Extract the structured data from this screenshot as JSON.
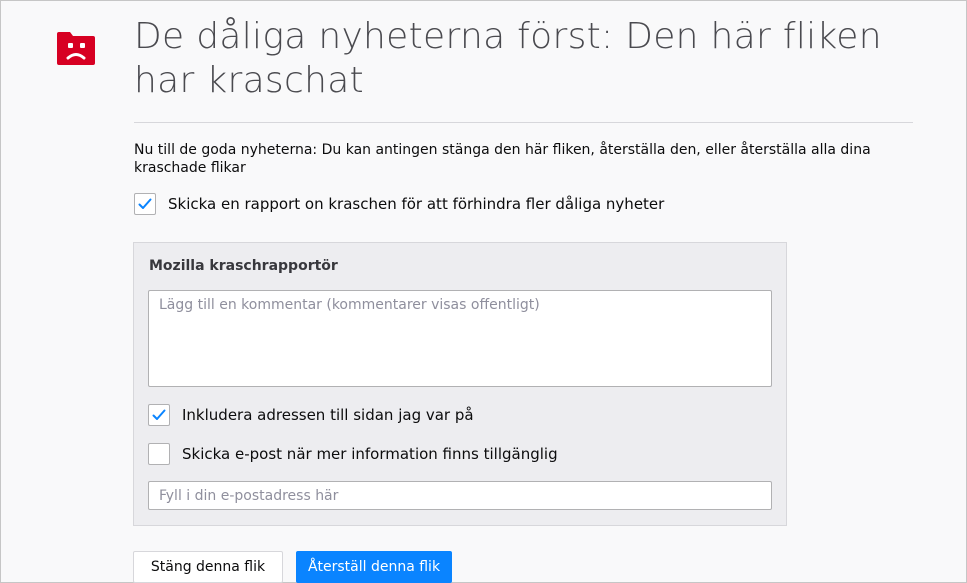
{
  "page": {
    "title": "De dåliga nyheterna först: Den här fliken har kraschat",
    "description": "Nu till de goda nyheterna: Du kan antingen stänga den här fliken, återställa den, eller återställa alla dina kraschade flikar",
    "icon": "sad-tab-icon"
  },
  "report": {
    "send_label": "Skicka en rapport on kraschen för att förhindra fler dåliga nyheter",
    "send_checked": true
  },
  "reporter": {
    "title": "Mozilla kraschrapportör",
    "comment_placeholder": "Lägg till en kommentar (kommentarer visas offentligt)",
    "comment_value": "",
    "include_url_label": "Inkludera adressen till sidan jag var på",
    "include_url_checked": true,
    "email_me_label": "Skicka e-post när mer information finns tillgänglig",
    "email_me_checked": false,
    "email_placeholder": "Fyll i din e-postadress här",
    "email_value": ""
  },
  "buttons": {
    "close_label": "Stäng denna flik",
    "restore_label": "Återställ denna flik"
  },
  "colors": {
    "accent": "#0a84ff",
    "icon_red": "#d70022",
    "title_gray": "#4a4a4f",
    "box_bg": "#ededf0"
  }
}
